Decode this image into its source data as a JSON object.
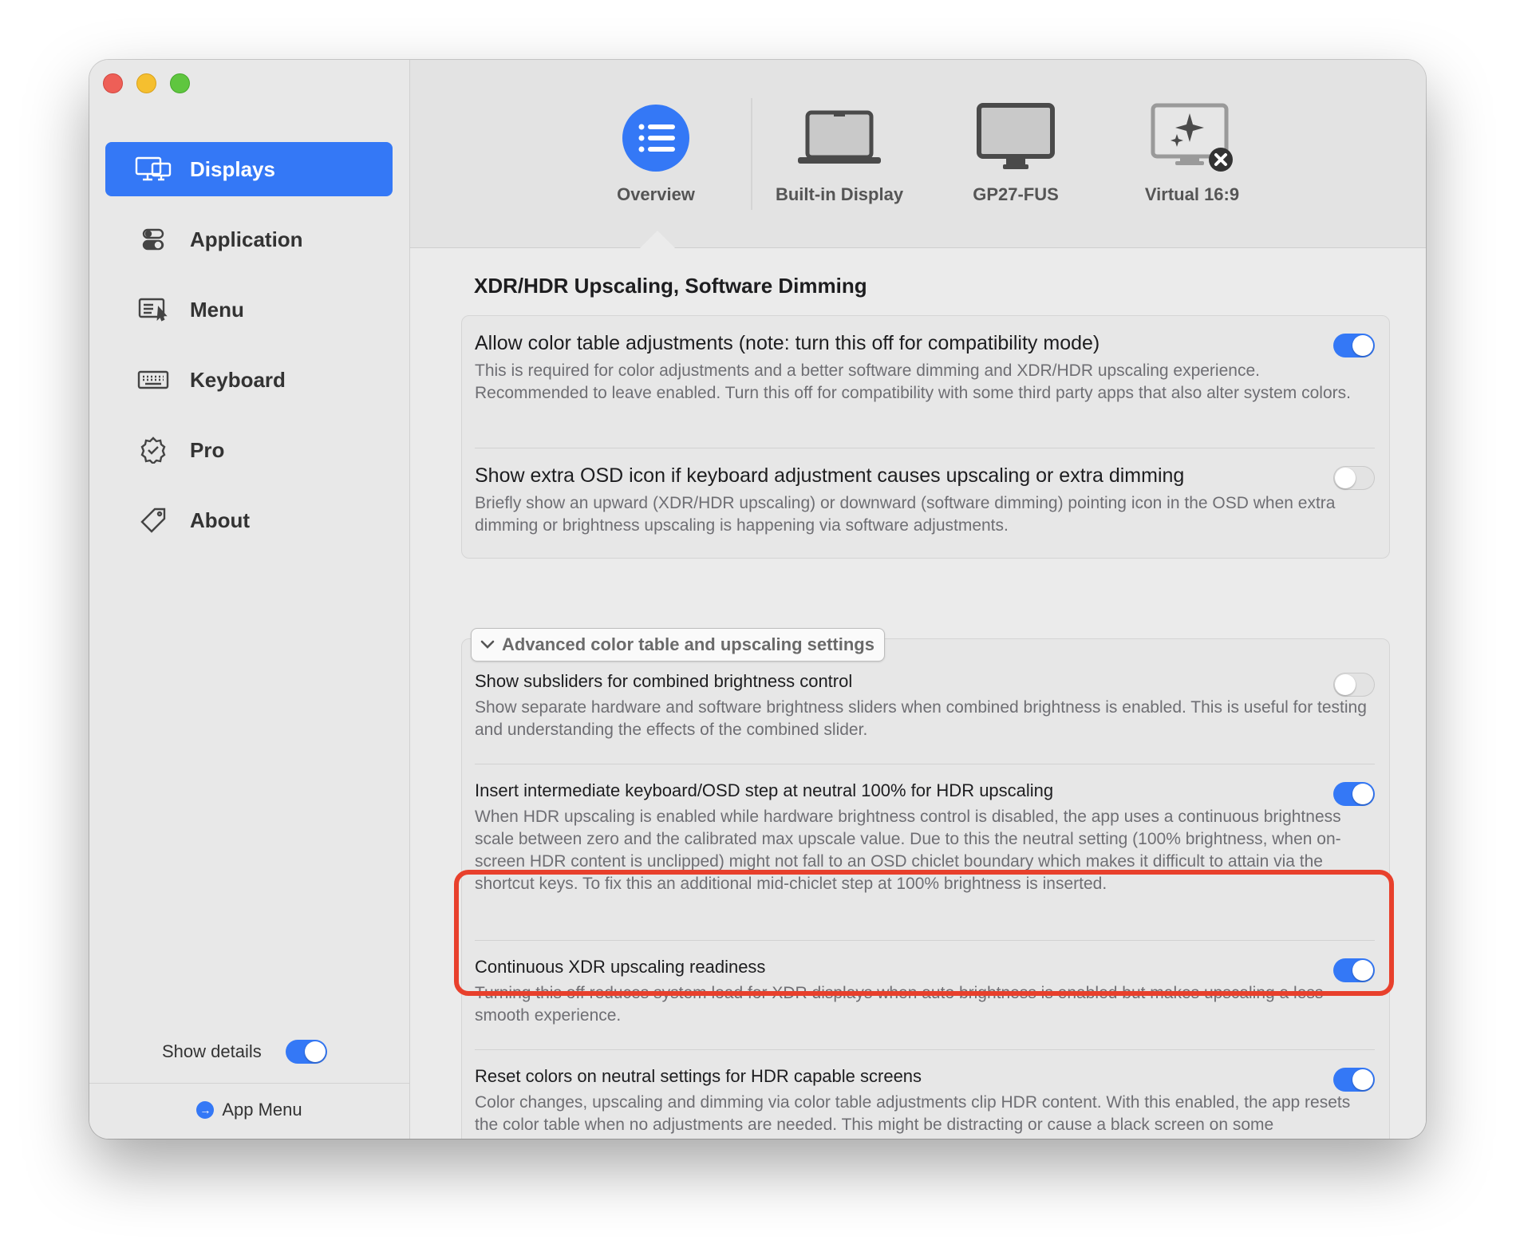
{
  "sidebar": {
    "items": [
      {
        "label": "Displays",
        "icon": "displays-icon",
        "active": true
      },
      {
        "label": "Application",
        "icon": "application-toggles-icon",
        "active": false
      },
      {
        "label": "Menu",
        "icon": "menu-icon",
        "active": false
      },
      {
        "label": "Keyboard",
        "icon": "keyboard-icon",
        "active": false
      },
      {
        "label": "Pro",
        "icon": "pro-badge-icon",
        "active": false
      },
      {
        "label": "About",
        "icon": "tag-icon",
        "active": false
      }
    ],
    "show_details_label": "Show details",
    "show_details_on": true,
    "app_menu_label": "App Menu"
  },
  "toolbar": {
    "tabs": [
      {
        "label": "Overview",
        "icon": "list-icon",
        "selected": true
      },
      {
        "label": "Built-in Display",
        "icon": "laptop-icon",
        "selected": false
      },
      {
        "label": "GP27-FUS",
        "icon": "monitor-icon",
        "selected": false
      },
      {
        "label": "Virtual 16:9",
        "icon": "virtual-display-icon",
        "selected": false
      }
    ]
  },
  "main": {
    "section_title": "XDR/HDR Upscaling, Software Dimming",
    "card1": [
      {
        "title": "Allow color table adjustments (note: turn this off for compatibility mode)",
        "desc": "This is required for color adjustments and a better software dimming and XDR/HDR upscaling experience. Recommended to leave enabled. Turn this off for compatibility with some third party apps that also alter system colors.",
        "on": true
      },
      {
        "title": "Show extra OSD icon if keyboard adjustment causes upscaling or extra dimming",
        "desc": "Briefly show an upward (XDR/HDR upscaling) or downward (software dimming) pointing icon in the OSD when extra dimming or brightness upscaling is happening via software adjustments.",
        "on": false
      }
    ],
    "advanced_label": "Advanced color table and upscaling settings",
    "card2": [
      {
        "title": "Show subsliders for combined brightness control",
        "desc": "Show separate hardware and software brightness sliders when combined brightness is enabled. This is useful for testing and understanding the effects of the combined slider.",
        "on": false
      },
      {
        "title": "Insert intermediate keyboard/OSD step at neutral 100% for HDR upscaling",
        "desc": "When HDR upscaling is enabled while hardware brightness control is disabled, the app uses a continuous brightness scale between zero and the calibrated max upscale value. Due to this the neutral setting (100% brightness, when on-screen HDR content is unclipped) might not fall to an OSD chiclet boundary which makes it difficult to attain via the shortcut keys. To fix this an additional mid-chiclet step at 100% brightness is inserted.",
        "on": true
      },
      {
        "title": "Continuous XDR upscaling readiness",
        "desc": "Turning this off reduces system load for XDR displays when auto brightness is enabled but makes upscaling a less smooth experience.",
        "on": true
      },
      {
        "title": "Reset colors on neutral settings for HDR capable screens",
        "desc": "Color changes, upscaling and dimming via color table adjustments clip HDR content. With this enabled, the app resets the color table when no adjustments are needed. This might be distracting or cause a black screen on some configurations.",
        "on": true
      }
    ]
  },
  "colors": {
    "accent": "#3478f6",
    "highlight": "#e8402c"
  }
}
